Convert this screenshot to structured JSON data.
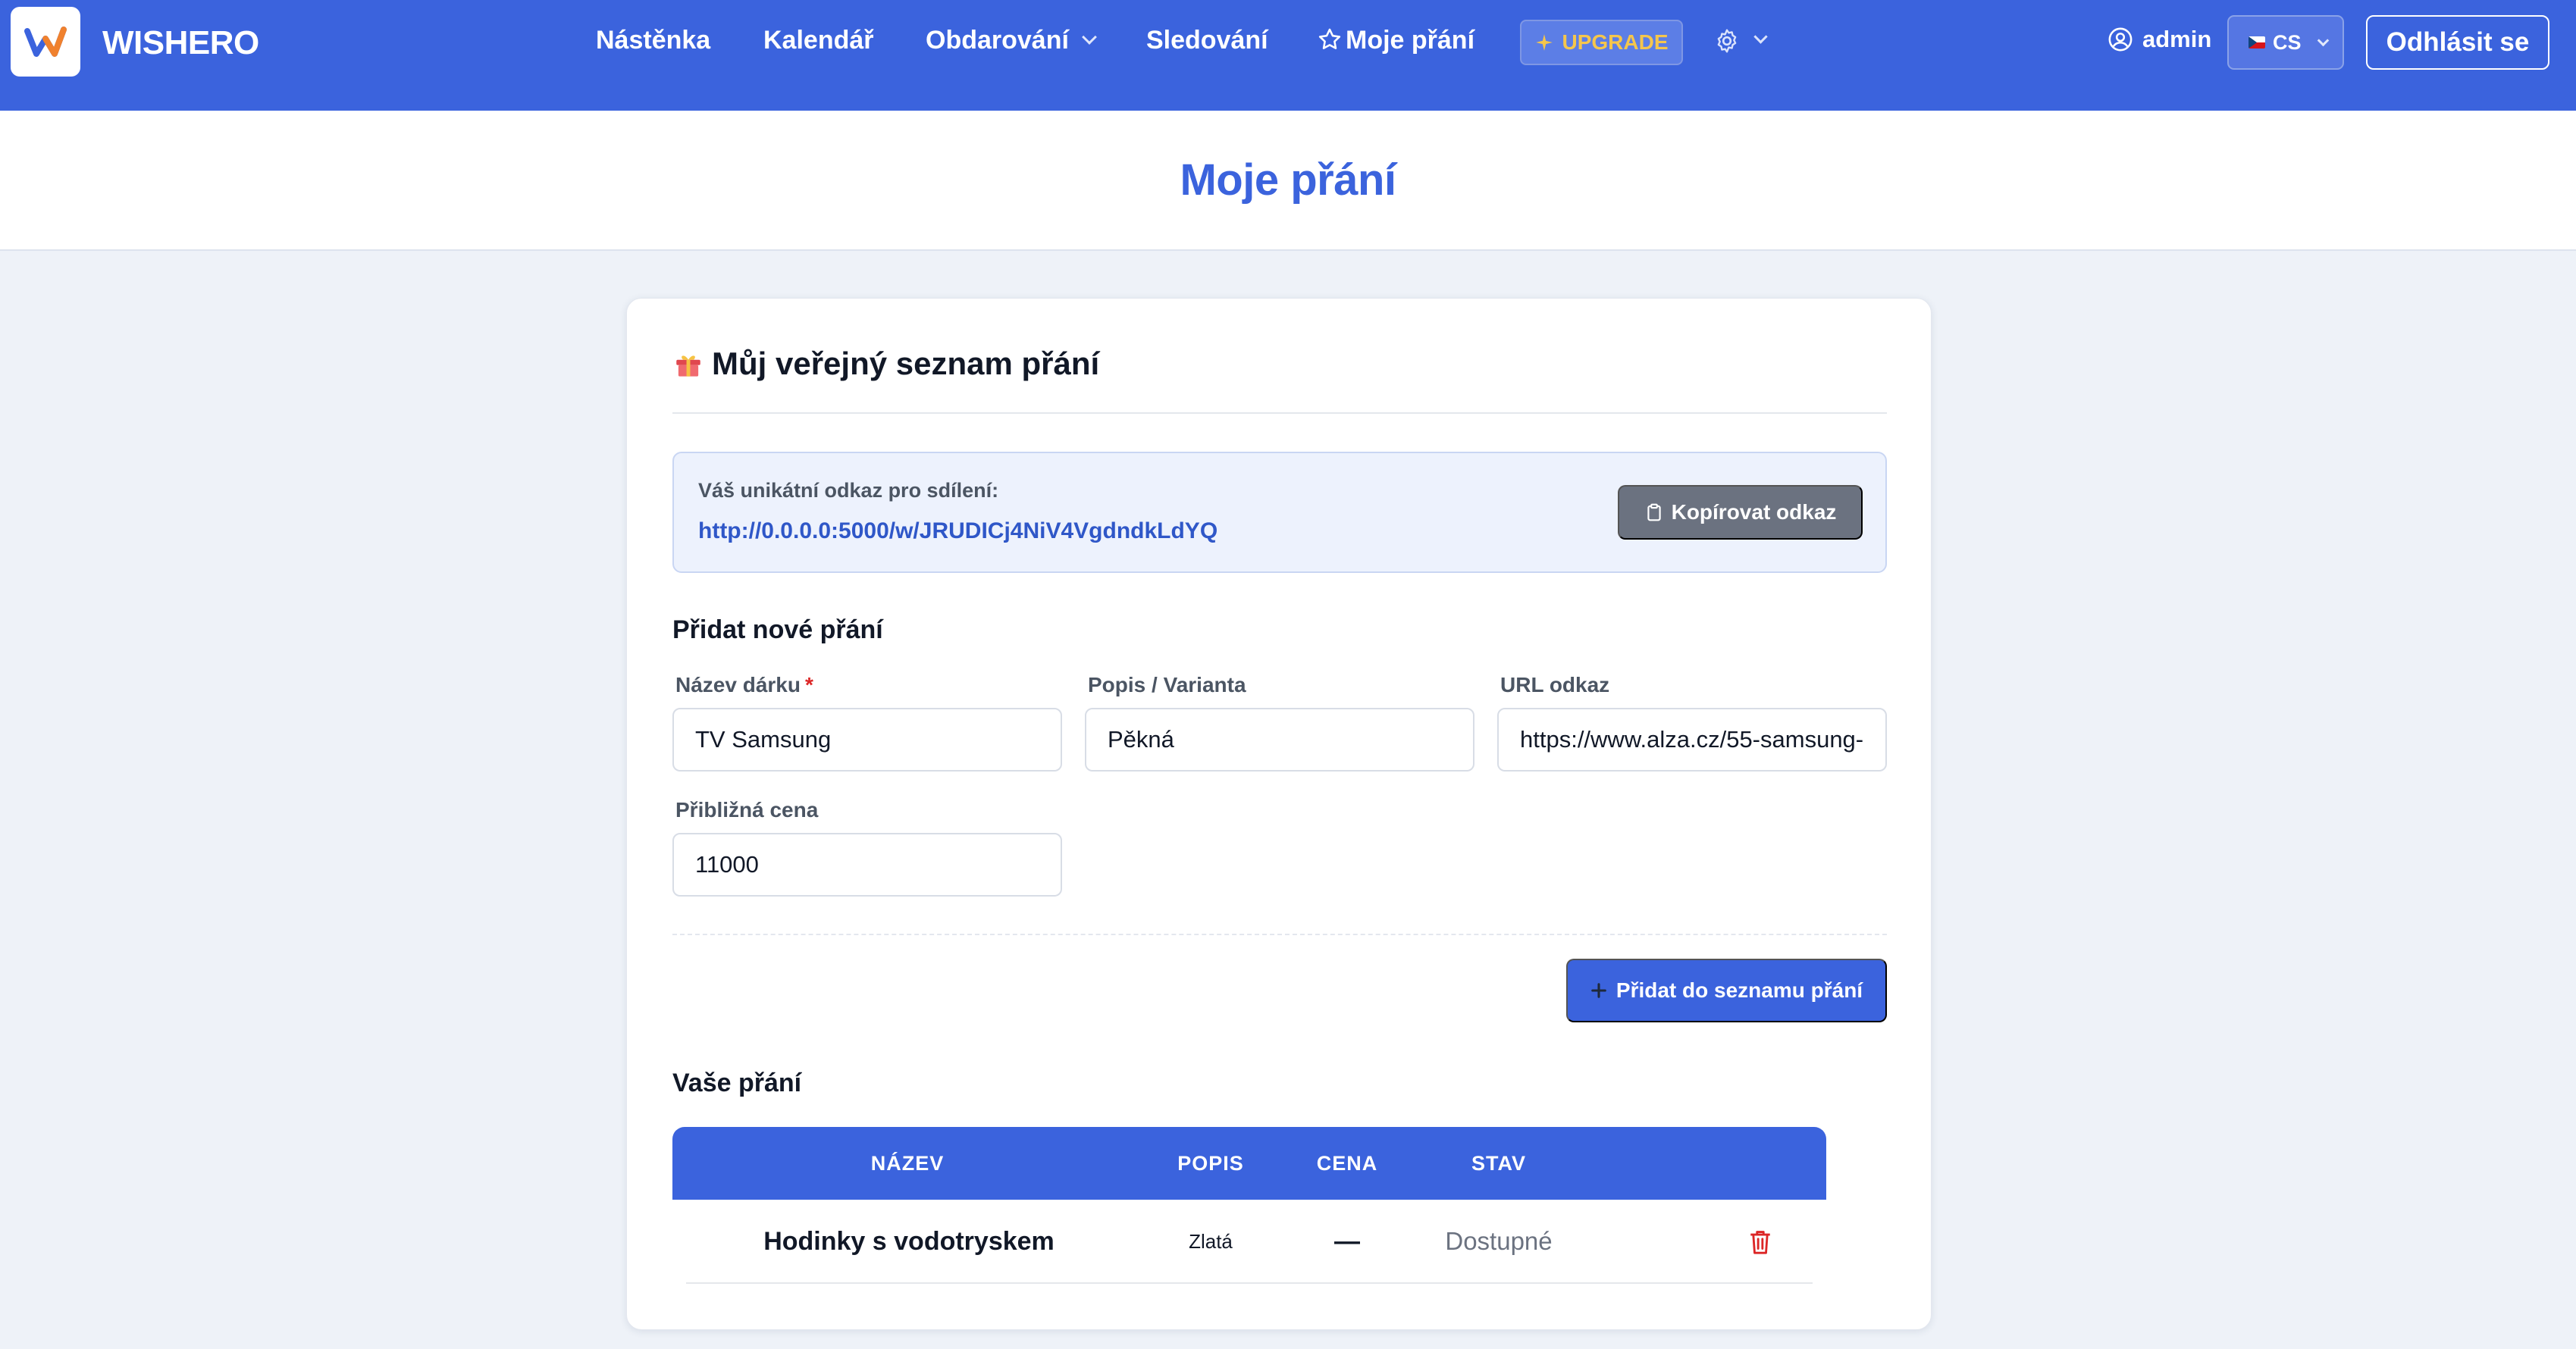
{
  "brand": {
    "name": "WISHERO"
  },
  "nav": {
    "items": [
      {
        "label": "Nástěnka"
      },
      {
        "label": "Kalendář"
      },
      {
        "label": "Obdarování"
      },
      {
        "label": "Sledování"
      },
      {
        "label": "Moje přání"
      }
    ],
    "upgrade_label": "UPGRADE",
    "user_label": "admin",
    "language": "CS",
    "logout_label": "Odhlásit se"
  },
  "page": {
    "title": "Moje přání"
  },
  "card": {
    "title": "Můj veřejný seznam přání",
    "share": {
      "label": "Váš unikátní odkaz pro sdílení:",
      "url": "http://0.0.0.0:5000/w/JRUDICj4NiV4VgdndkLdYQ",
      "copy_label": "Kopírovat odkaz"
    },
    "add_form": {
      "heading": "Přidat nové přání",
      "name_label": "Název dárku",
      "required_mark": "*",
      "name_value": "TV Samsung",
      "desc_label": "Popis / Varianta",
      "desc_value": "Pěkná",
      "url_label": "URL odkaz",
      "url_value": "https://www.alza.cz/55-samsung-",
      "price_label": "Přibližná cena",
      "price_value": "11000",
      "submit_label": "Přidat do seznamu přání"
    },
    "wishes": {
      "heading": "Vaše přání",
      "columns": [
        "NÁZEV",
        "POPIS",
        "CENA",
        "STAV"
      ],
      "rows": [
        {
          "name": "Hodinky s vodotryskem",
          "description": "Zlatá",
          "price": "—",
          "status": "Dostupné"
        }
      ]
    }
  },
  "colors": {
    "primary": "#3b63dd",
    "upgrade_text": "#f5c64c",
    "status_muted": "#6b7280",
    "danger": "#dc2626"
  },
  "icons": {
    "logo": "wishero-logo-icon",
    "moje_prani": "star-icon",
    "upgrade": "sparkle-icon",
    "settings": "gear-icon",
    "user": "user-circle-icon",
    "card_title": "gift-icon",
    "copy": "clipboard-icon",
    "add": "plus-icon",
    "delete": "trash-icon"
  }
}
